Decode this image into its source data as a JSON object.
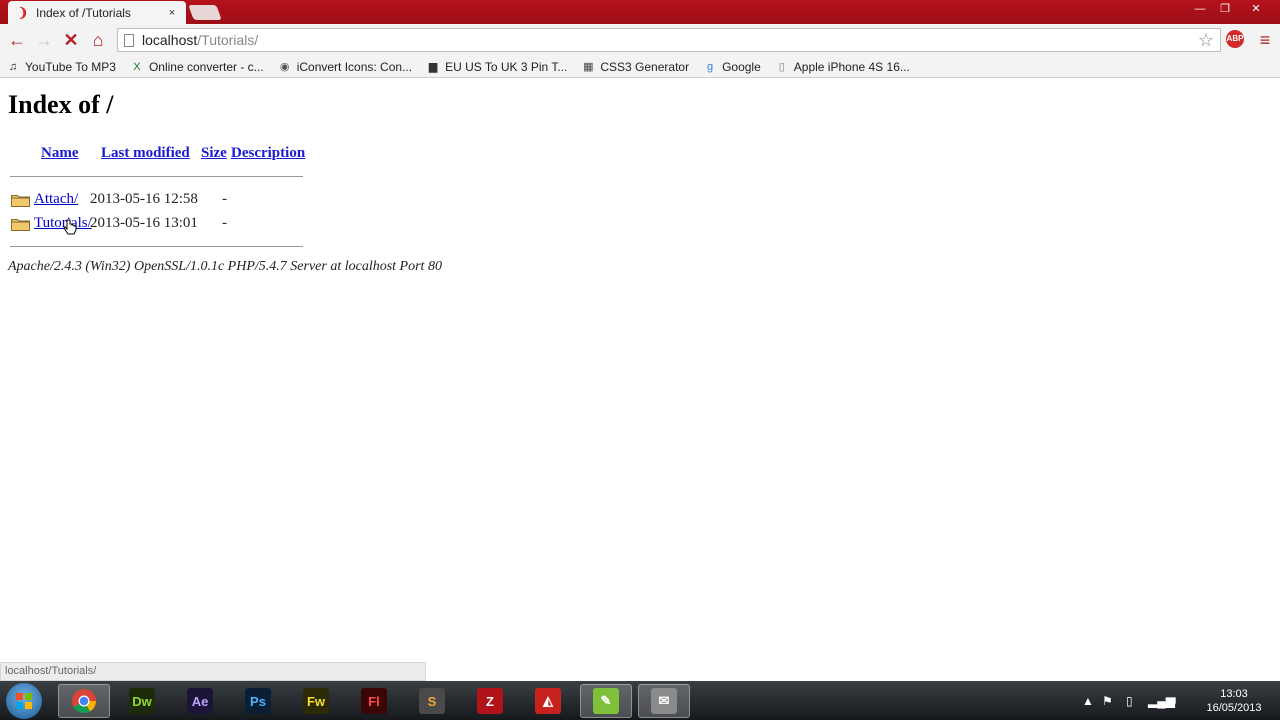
{
  "browser": {
    "tab": {
      "title": "Index of /Tutorials",
      "close": "×"
    },
    "window_controls": {
      "minimize": "—",
      "maximize": "❐",
      "close": "✕"
    },
    "toolbar": {
      "back": "←",
      "forward": "→",
      "stop": "✕",
      "home": "⌂",
      "url_host": "localhost",
      "url_path": "/Tutorials/",
      "star": "☆",
      "menu": "≡"
    },
    "bookmarks": [
      {
        "label": "YouTube To MP3",
        "icon": "music-note-icon",
        "glyph": "♫",
        "color": "#222222"
      },
      {
        "label": "Online converter - c...",
        "icon": "excel-icon",
        "glyph": "X",
        "color": "#1e7a1e"
      },
      {
        "label": "iConvert Icons: Con...",
        "icon": "ring-icon",
        "glyph": "◉",
        "color": "#555555"
      },
      {
        "label": "EU US To UK 3 Pin T...",
        "icon": "flag-icon",
        "glyph": "▆",
        "color": "#333333"
      },
      {
        "label": "CSS3 Generator",
        "icon": "css-icon",
        "glyph": "▦",
        "color": "#444444"
      },
      {
        "label": "Google",
        "icon": "google-icon",
        "glyph": "g",
        "color": "#3b78e7"
      },
      {
        "label": "Apple iPhone 4S 16...",
        "icon": "page-icon",
        "glyph": "▯",
        "color": "#888888"
      }
    ]
  },
  "page": {
    "heading": "Index of /",
    "columns": {
      "name": "Name",
      "last_modified": "Last modified",
      "size": "Size",
      "description": "Description"
    },
    "rows": [
      {
        "name": "Attach/",
        "modified": "2013-05-16 12:58",
        "size": "-"
      },
      {
        "name": "Tutorials/",
        "modified": "2013-05-16 13:01",
        "size": "-"
      }
    ],
    "address": "Apache/2.4.3 (Win32) OpenSSL/1.0.1c PHP/5.4.7 Server at localhost Port 80"
  },
  "status_bar": {
    "url": "localhost/Tutorials/"
  },
  "taskbar": {
    "apps": [
      {
        "name": "chrome",
        "label": "",
        "color": "#e8e8e8",
        "text_color": "#000000",
        "active": true
      },
      {
        "name": "dreamweaver",
        "label": "Dw",
        "color": "#1d2b0a",
        "text_color": "#8fd63a",
        "active": false
      },
      {
        "name": "after-effects",
        "label": "Ae",
        "color": "#1b1436",
        "text_color": "#b7a2ff",
        "active": false
      },
      {
        "name": "photoshop",
        "label": "Ps",
        "color": "#0b1f34",
        "text_color": "#4fb3ff",
        "active": false
      },
      {
        "name": "fireworks",
        "label": "Fw",
        "color": "#2c2a06",
        "text_color": "#f3de3a",
        "active": false
      },
      {
        "name": "flash",
        "label": "Fl",
        "color": "#3b0606",
        "text_color": "#ff4a4a",
        "active": false
      },
      {
        "name": "sublime-text",
        "label": "S",
        "color": "#4a4a4a",
        "text_color": "#f3a53a",
        "active": false
      },
      {
        "name": "filezilla",
        "label": "Z",
        "color": "#b1131b",
        "text_color": "#ffffff",
        "active": false
      },
      {
        "name": "sketchup",
        "label": "◭",
        "color": "#c8221f",
        "text_color": "#ffffff",
        "active": false
      },
      {
        "name": "notepad-chart",
        "label": "✎",
        "color": "#7fbf3a",
        "text_color": "#ffffff",
        "active": true
      },
      {
        "name": "mail-app",
        "label": "✉",
        "color": "#8a8a8a",
        "text_color": "#ffffff",
        "active": true
      }
    ],
    "clock": {
      "time": "13:03",
      "date": "16/05/2013"
    }
  },
  "colors": {
    "titlebar": "#b5121b",
    "link": "#1a1ad4",
    "visited": "#551a8b"
  }
}
